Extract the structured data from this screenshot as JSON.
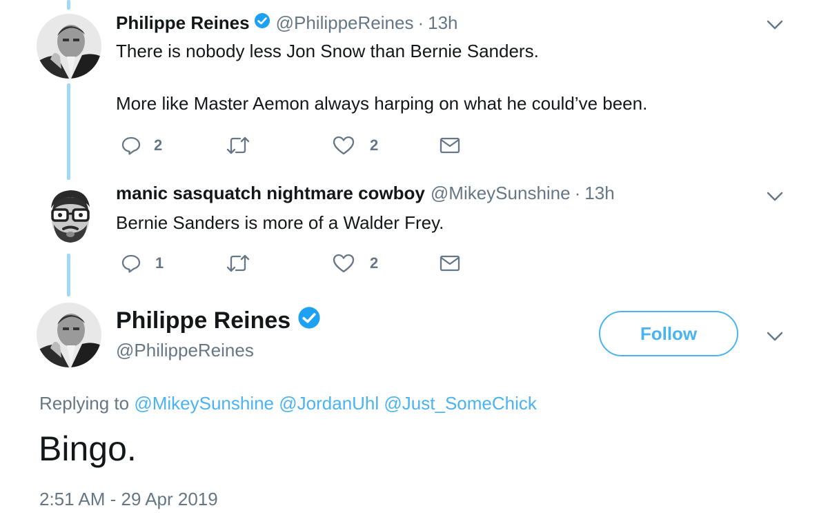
{
  "tweets": [
    {
      "name": "Philippe Reines",
      "handle": "@PhilippeReines",
      "time": "13h",
      "verified": true,
      "lines": [
        "There is nobody less Jon Snow than Bernie Sanders.",
        "More like Master Aemon always harping on what he could’ve been."
      ],
      "replies": "2",
      "retweets": "",
      "likes": "2"
    },
    {
      "name": "manic sasquatch nightmare cowboy",
      "handle": "@MikeySunshine",
      "time": "13h",
      "verified": false,
      "lines": [
        "Bernie Sanders is more of a Walder Frey."
      ],
      "replies": "1",
      "retweets": "",
      "likes": "2"
    }
  ],
  "main_tweet": {
    "name": "Philippe Reines",
    "handle": "@PhilippeReines",
    "follow_label": "Follow",
    "replying_prefix": "Replying to",
    "mentions": [
      "@MikeySunshine",
      "@JordanUhl",
      "@Just_SomeChick"
    ],
    "text": "Bingo.",
    "timestamp": "2:51 AM - 29 Apr 2019"
  },
  "colors": {
    "accent": "#4ab3f4",
    "thread_line": "#9fd9f5",
    "muted": "#657786",
    "text": "#14171a",
    "verified": "#1da1f2"
  }
}
